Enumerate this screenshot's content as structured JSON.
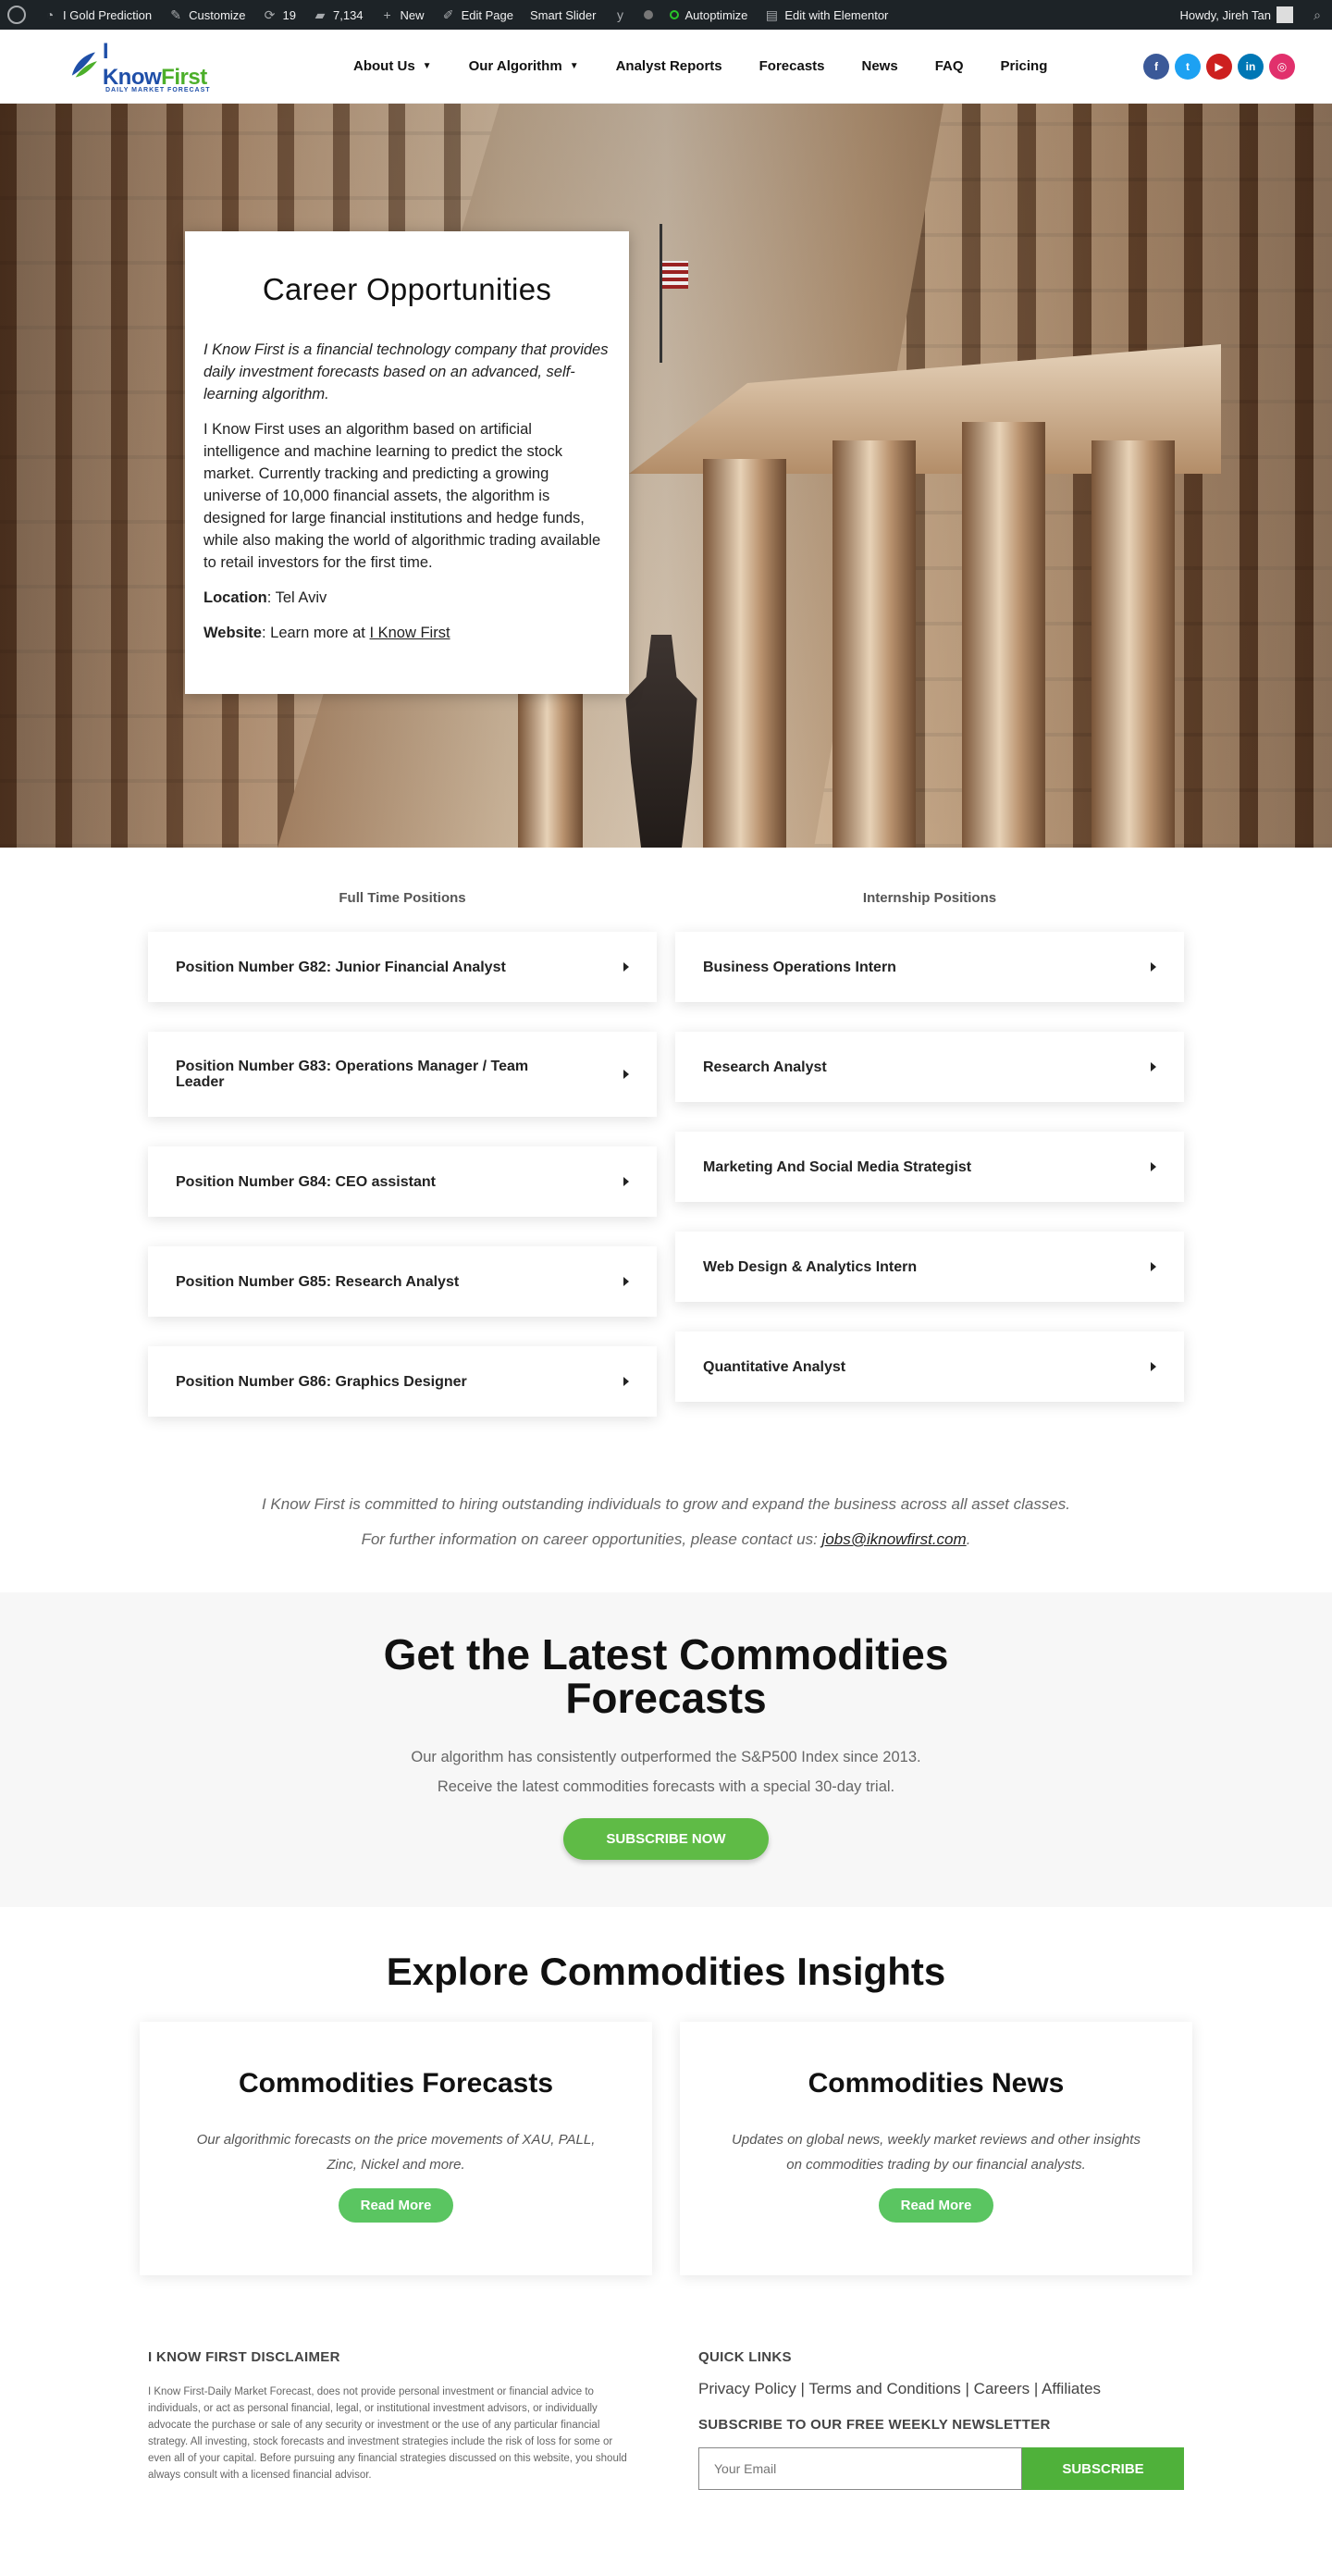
{
  "adminbar": {
    "site": "I Gold Prediction",
    "customize": "Customize",
    "updates": "19",
    "comments": "7,134",
    "new": "New",
    "edit_page": "Edit Page",
    "smart_slider": "Smart Slider",
    "autoptimize": "Autoptimize",
    "elementor": "Edit with Elementor",
    "howdy": "Howdy, Jireh Tan"
  },
  "logo": {
    "text_a": "I Know",
    "text_b": "First",
    "sub": "DAILY MARKET FORECAST"
  },
  "nav": [
    {
      "label": "About Us",
      "dropdown": true
    },
    {
      "label": "Our Algorithm",
      "dropdown": true
    },
    {
      "label": "Analyst Reports",
      "dropdown": false
    },
    {
      "label": "Forecasts",
      "dropdown": false
    },
    {
      "label": "News",
      "dropdown": false
    },
    {
      "label": "FAQ",
      "dropdown": false
    },
    {
      "label": "Pricing",
      "dropdown": false
    }
  ],
  "social": [
    {
      "icon": "facebook-icon",
      "glyph": "f",
      "color": "#3b5998"
    },
    {
      "icon": "twitter-icon",
      "glyph": "t",
      "color": "#1da1f2"
    },
    {
      "icon": "youtube-icon",
      "glyph": "▶",
      "color": "#cd201f"
    },
    {
      "icon": "linkedin-icon",
      "glyph": "in",
      "color": "#0077b5"
    },
    {
      "icon": "instagram-icon",
      "glyph": "◎",
      "color": "#e1306c"
    }
  ],
  "hero": {
    "title": "Career Opportunities",
    "intro": "I Know First is a financial technology company that provides daily investment forecasts based on an advanced, self-learning algorithm.",
    "body": "I Know First uses an algorithm based on artificial intelligence and machine learning to predict the stock market. Currently tracking and predicting a growing universe of 10,000 financial assets, the algorithm is designed for large financial institutions and hedge funds, while also making the world of algorithmic trading available to retail investors for the first time.",
    "location_label": "Location",
    "location_value": ": Tel Aviv",
    "website_label": "Website",
    "website_prefix": ": Learn more at ",
    "website_link": "I Know First"
  },
  "positions": {
    "full_time_heading": "Full Time Positions",
    "internship_heading": "Internship Positions",
    "full_time": [
      "Position Number G82: Junior Financial Analyst",
      "Position Number G83: Operations Manager / Team Leader",
      "Position Number G84: CEO assistant",
      "Position Number G85: Research Analyst",
      "Position Number G86: Graphics Designer"
    ],
    "internship": [
      "Business Operations Intern",
      "Research Analyst",
      "Marketing And Social Media Strategist",
      "Web Design & Analytics Intern",
      "Quantitative Analyst"
    ]
  },
  "commitment": {
    "line1": "I Know First is committed to hiring outstanding individuals to grow and expand the business across all asset classes.",
    "line2_prefix": "For further information on career opportunities, please contact us: ",
    "email": "jobs@iknowfirst.com",
    "line2_suffix": "."
  },
  "cta": {
    "title": "Get the Latest Commodities Forecasts",
    "sub1": "Our algorithm has consistently outperformed the S&P500 Index since 2013.",
    "sub2": "Receive the latest commodities forecasts with a special 30-day trial.",
    "button": "SUBSCRIBE NOW"
  },
  "insights": {
    "title": "Explore Commodities Insights",
    "cards": [
      {
        "title": "Commodities Forecasts",
        "text": "Our algorithmic forecasts on the price movements of XAU, PALL, Zinc, Nickel and more.",
        "button": "Read More"
      },
      {
        "title": "Commodities News",
        "text": "Updates on global news, weekly market reviews and other insights on commodities trading by our financial analysts.",
        "button": "Read More"
      }
    ]
  },
  "footer": {
    "disclaimer_heading": "I KNOW FIRST DISCLAIMER",
    "disclaimer": "I Know First-Daily Market Forecast, does not provide personal investment or financial advice to individuals, or act as personal financial, legal, or institutional investment advisors, or individually advocate the purchase or sale of any security or investment or the use of any particular financial strategy. All investing, stock forecasts and investment strategies include the risk of loss for some or even all of your capital. Before pursuing any financial strategies discussed on this website, you should always consult with a licensed financial advisor.",
    "quick_links_heading": "QUICK LINKS",
    "quick_links": [
      "Privacy Policy",
      "Terms and Conditions",
      "Careers",
      "Affiliates"
    ],
    "newsletter_heading": "SUBSCRIBE TO OUR FREE WEEKLY NEWSLETTER",
    "email_placeholder": "Your Email",
    "subscribe_button": "SUBSCRIBE"
  }
}
